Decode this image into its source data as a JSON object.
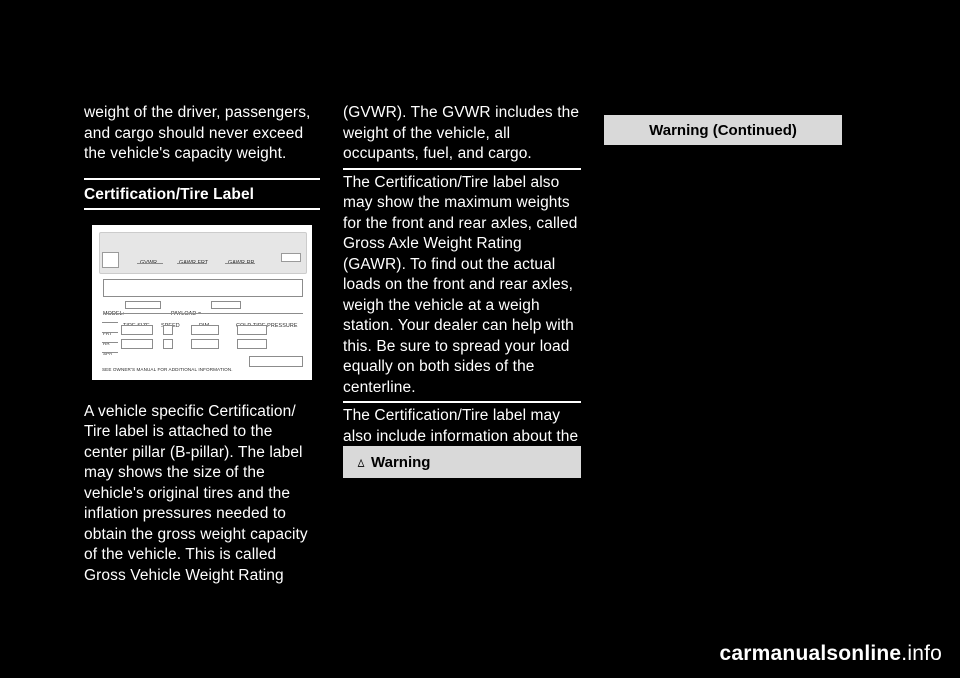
{
  "page": {
    "background": "#000000",
    "text_color": "#ffffff"
  },
  "column1": {
    "paragraph1": "weight of the driver, passengers, and cargo should never exceed the vehicle's capacity weight.",
    "heading": "Certification/Tire Label",
    "paragraph2": "A vehicle specific Certification/ Tire label is attached to the center pillar (B-pillar). The label may shows the size of the vehicle's original tires and the inflation pressures needed to obtain the gross weight capacity of the vehicle. This is called Gross Vehicle Weight Rating",
    "figure": {
      "name": "certification-tire-label-illustration",
      "labels": {
        "gvwr": "GVWR",
        "gawr_frt": "GAWR FRT",
        "gawr_rr": "GAWR RR",
        "model": "MODEL:",
        "payload": "PAYLOAD =",
        "tire_size": "TIRE SIZE",
        "speed": "SPEED",
        "rim": "RIM",
        "cold_tire_pressure": "COLD TIRE PRESSURE",
        "row_frt": "FRT",
        "row_rr": "RR",
        "row_spa": "SPA",
        "footer_note": "SEE OWNER'S MANUAL FOR ADDITIONAL INFORMATION."
      }
    }
  },
  "column2": {
    "paragraph1": "(GVWR). The GVWR includes the weight of the vehicle, all occupants, fuel, and cargo.",
    "paragraph2": "The Certification/Tire label also may show the maximum weights for the front and rear axles, called Gross Axle Weight Rating (GAWR). To find out the actual loads on the front and rear axles, weigh the vehicle at a weigh station. Your dealer can help with this. Be sure to spread your load equally on both sides of the centerline.",
    "paragraph3": "The Certification/Tire label may also include information about the Front Axle Reserve Capacity.",
    "warning": {
      "icon": "warning-triangle-icon",
      "label": "Warning",
      "background": "#d9d9d9"
    }
  },
  "column3": {
    "warning_continued": {
      "label": "Warning  (Continued)",
      "background": "#d9d9d9"
    }
  },
  "footer": {
    "text_bold": "carmanualsonline",
    "text_plain": ".info"
  }
}
